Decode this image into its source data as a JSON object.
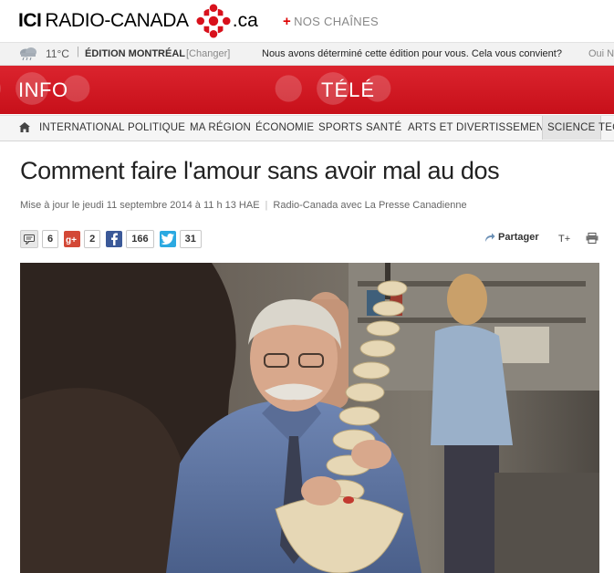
{
  "header": {
    "logo_ici": "ICI",
    "logo_name": "RADIO-CANADA",
    "logo_tld": ".ca",
    "nos_chaines": "NOS CHAÎNES",
    "plus_symbol": "+"
  },
  "weather": {
    "icon": "cloud-rain-icon",
    "temperature": "11°C",
    "separator": "|",
    "edition": "ÉDITION MONTRÉAL",
    "change": "[Changer]",
    "message": "Nous avons déterminé cette édition pour vous. Cela vous convient?",
    "yes_link": "Oui N"
  },
  "channels": {
    "info": "INFO",
    "tele": "TÉLÉ"
  },
  "nav": {
    "items": [
      "INTERNATIONAL",
      "POLITIQUE",
      "MA RÉGION",
      "ÉCONOMIE",
      "SPORTS",
      "SANTÉ",
      "ARTS ET DIVERTISSEMENT",
      "SCIENCE",
      "TEC"
    ],
    "active": "SCIENCE"
  },
  "article": {
    "title": "Comment faire l'amour sans avoir mal au dos",
    "updated": "Mise à jour le jeudi 11 septembre 2014 à 11 h 13 HAE",
    "separator": "|",
    "source": "Radio-Canada avec La Presse Canadienne"
  },
  "social": {
    "comments": "6",
    "googleplus": "2",
    "facebook": "166",
    "twitter": "31",
    "share_label": "Partager",
    "text_size": "T+"
  },
  "colors": {
    "brand_red": "#d8111c",
    "facebook": "#3b5998",
    "twitter": "#2ba9e1",
    "googleplus": "#d34836"
  }
}
